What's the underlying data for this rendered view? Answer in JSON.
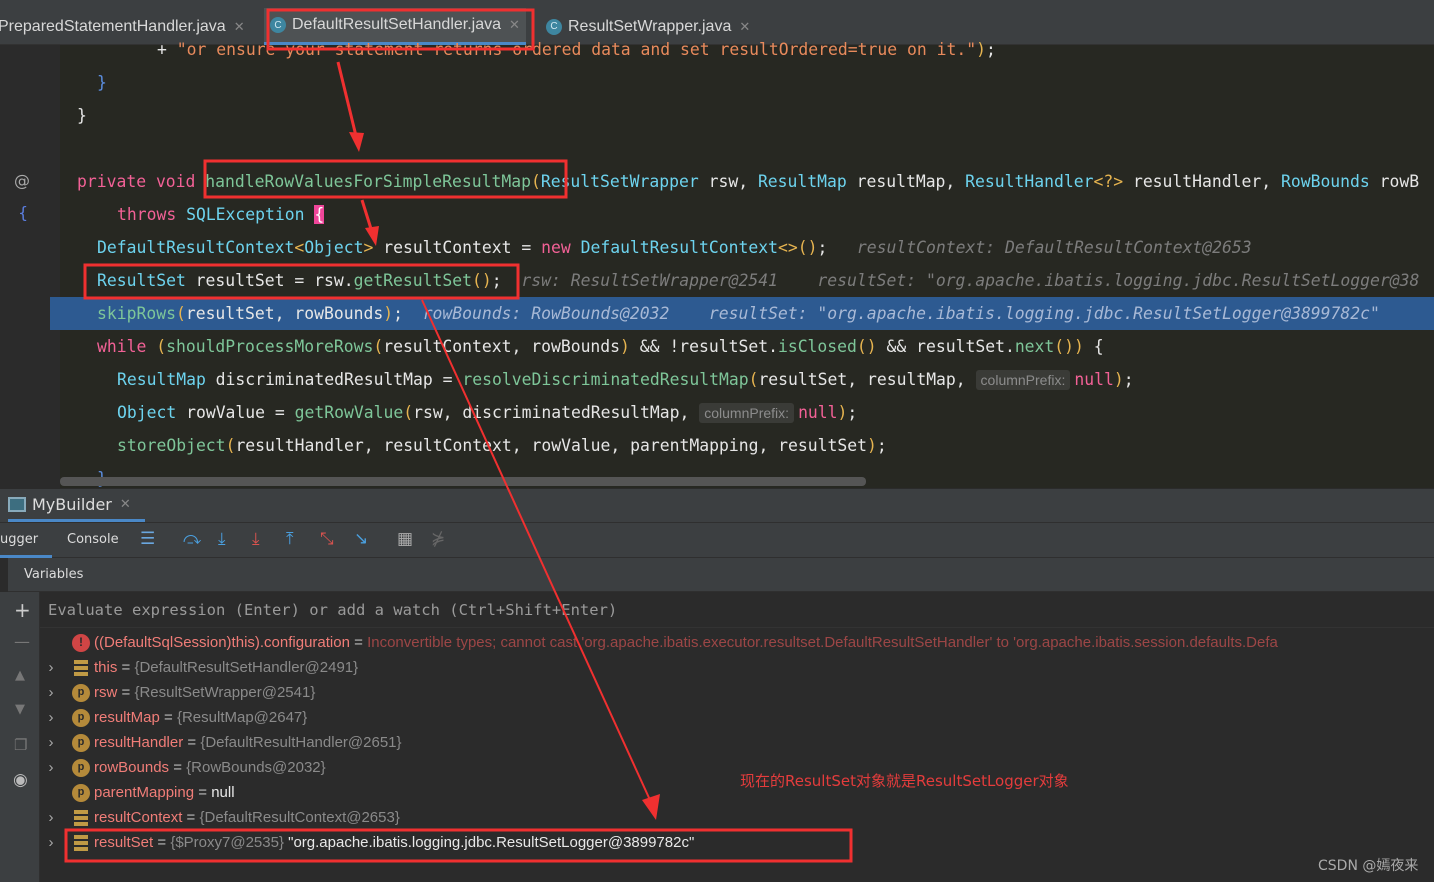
{
  "tabs": [
    {
      "label": "PreparedStatementHandler.java",
      "active": false
    },
    {
      "label": "DefaultResultSetHandler.java",
      "active": true
    },
    {
      "label": "ResultSetWrapper.java",
      "active": false
    }
  ],
  "code": [
    [
      [
        "pl",
        "+ "
      ],
      [
        "st",
        "\"or ensure your statement returns ordered data and set resultOrdered=true on it.\""
      ],
      [
        "br",
        ")"
      ],
      [
        "pl",
        ";"
      ]
    ],
    [
      [
        "bl",
        "}"
      ]
    ],
    [
      [
        "pl",
        "}"
      ]
    ],
    [],
    [
      [
        "kw",
        "private void "
      ],
      [
        "fn",
        "handleRowValuesForSimpleResultMap"
      ],
      [
        "br",
        "("
      ],
      [
        "ty",
        "ResultSetWrapper"
      ],
      [
        "pl",
        " rsw, "
      ],
      [
        "ty",
        "ResultMap"
      ],
      [
        "pl",
        " resultMap, "
      ],
      [
        "ty",
        "ResultHandler"
      ],
      [
        "br",
        "<?>"
      ],
      [
        "pl",
        " resultHandler, "
      ],
      [
        "ty",
        "RowBounds"
      ],
      [
        "pl",
        " rowB"
      ]
    ],
    [
      [
        "kw",
        "throws "
      ],
      [
        "ty",
        "SQLException"
      ],
      [
        "pl",
        " "
      ],
      [
        "cur",
        "{"
      ]
    ],
    [
      [
        "ty",
        "DefaultResultContext"
      ],
      [
        "br",
        "<"
      ],
      [
        "ty",
        "Object"
      ],
      [
        "br",
        ">"
      ],
      [
        "pl",
        " resultContext = "
      ],
      [
        "kw",
        "new "
      ],
      [
        "ty",
        "DefaultResultContext"
      ],
      [
        "br",
        "<>()"
      ],
      [
        "pl",
        ";"
      ],
      [
        "hint",
        "   resultContext: DefaultResultContext@2653"
      ]
    ],
    [
      [
        "ty",
        "ResultSet"
      ],
      [
        "pl",
        " resultSet = rsw."
      ],
      [
        "fn",
        "getResultSet"
      ],
      [
        "br",
        "()"
      ],
      [
        "pl",
        ";"
      ],
      [
        "hint",
        "  rsw: ResultSetWrapper@2541    resultSet: \"org.apache.ibatis.logging.jdbc.ResultSetLogger@38"
      ]
    ],
    [
      [
        "fn",
        "skipRows"
      ],
      [
        "br",
        "("
      ],
      [
        "pl",
        "resultSet, rowBounds"
      ],
      [
        "br",
        ")"
      ],
      [
        "pl",
        ";"
      ],
      [
        "hint",
        "  rowBounds: RowBounds@2032    resultSet: \"org.apache.ibatis.logging.jdbc.ResultSetLogger@3899782c\""
      ]
    ],
    [
      [
        "kw",
        "while "
      ],
      [
        "br",
        "("
      ],
      [
        "fn",
        "shouldProcessMoreRows"
      ],
      [
        "br",
        "("
      ],
      [
        "pl",
        "resultContext, rowBounds"
      ],
      [
        "br",
        ")"
      ],
      [
        "pl",
        " && !resultSet."
      ],
      [
        "fn",
        "isClosed"
      ],
      [
        "br",
        "()"
      ],
      [
        "pl",
        " && resultSet."
      ],
      [
        "fn",
        "next"
      ],
      [
        "br",
        "())"
      ],
      [
        "pl",
        " {"
      ]
    ],
    [
      [
        "ty",
        "ResultMap"
      ],
      [
        "pl",
        " discriminatedResultMap = "
      ],
      [
        "fn",
        "resolveDiscriminatedResultMap"
      ],
      [
        "br",
        "("
      ],
      [
        "pl",
        "resultSet, resultMap, "
      ],
      [
        "inlay",
        "columnPrefix:"
      ],
      [
        "kw",
        "null"
      ],
      [
        "br",
        ")"
      ],
      [
        "pl",
        ";"
      ]
    ],
    [
      [
        "ty",
        "Object"
      ],
      [
        "pl",
        " rowValue = "
      ],
      [
        "fn",
        "getRowValue"
      ],
      [
        "br",
        "("
      ],
      [
        "pl",
        "rsw, discriminatedResultMap, "
      ],
      [
        "inlay",
        "columnPrefix:"
      ],
      [
        "kw",
        "null"
      ],
      [
        "br",
        ")"
      ],
      [
        "pl",
        ";"
      ]
    ],
    [
      [
        "fn",
        "storeObject"
      ],
      [
        "br",
        "("
      ],
      [
        "pl",
        "resultHandler, resultContext, rowValue, parentMapping, resultSet"
      ],
      [
        "br",
        ")"
      ],
      [
        "pl",
        ";"
      ]
    ],
    [
      [
        "bl",
        "}"
      ]
    ]
  ],
  "tool_window": {
    "title": "MyBuilder",
    "tabs": [
      "ugger",
      "Console"
    ],
    "variables_label": "Variables",
    "eval_placeholder": "Evaluate expression (Enter) or add a watch (Ctrl+Shift+Enter)"
  },
  "variables": [
    {
      "icon": "error",
      "expand": false,
      "name": "((DefaultSqlSession)this).configuration",
      "value": "Inconvertible types; cannot cast 'org.apache.ibatis.executor.resultset.DefaultResultSetHandler' to 'org.apache.ibatis.session.defaults.Defa",
      "kind": "err"
    },
    {
      "icon": "field",
      "expand": true,
      "name": "this",
      "value": "{DefaultResultSetHandler@2491}",
      "kind": "obj"
    },
    {
      "icon": "param",
      "expand": true,
      "name": "rsw",
      "value": "{ResultSetWrapper@2541}",
      "kind": "obj"
    },
    {
      "icon": "param",
      "expand": true,
      "name": "resultMap",
      "value": "{ResultMap@2647}",
      "kind": "obj"
    },
    {
      "icon": "param",
      "expand": true,
      "name": "resultHandler",
      "value": "{DefaultResultHandler@2651}",
      "kind": "obj"
    },
    {
      "icon": "param",
      "expand": true,
      "name": "rowBounds",
      "value": "{RowBounds@2032}",
      "kind": "obj"
    },
    {
      "icon": "param",
      "expand": false,
      "name": "parentMapping",
      "value": "null",
      "kind": "null"
    },
    {
      "icon": "field",
      "expand": true,
      "name": "resultContext",
      "value": "{DefaultResultContext@2653}",
      "kind": "obj"
    },
    {
      "icon": "field",
      "expand": true,
      "name": "resultSet",
      "value": "{$Proxy7@2535}",
      "extra": "\"org.apache.ibatis.logging.jdbc.ResultSetLogger@3899782c\"",
      "kind": "obj"
    }
  ],
  "annotation": "现在的ResultSet对象就是ResultSetLogger对象",
  "watermark": "CSDN @嫣夜来",
  "colors": {
    "annotation_red": "#e63232",
    "highlight_line": "#2d5a91"
  }
}
